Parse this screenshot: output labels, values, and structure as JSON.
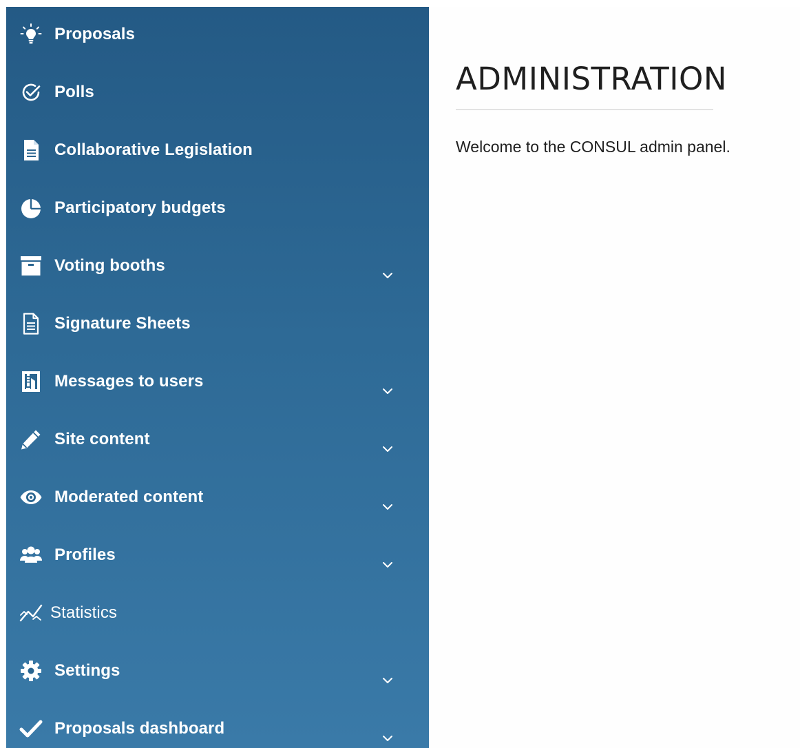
{
  "sidebar": {
    "items": [
      {
        "label": "Proposals",
        "icon": "lightbulb-icon",
        "has_submenu": false
      },
      {
        "label": "Polls",
        "icon": "check-circle-icon",
        "has_submenu": false
      },
      {
        "label": "Collaborative Legislation",
        "icon": "document-icon",
        "has_submenu": false
      },
      {
        "label": "Participatory budgets",
        "icon": "pie-chart-icon",
        "has_submenu": false
      },
      {
        "label": "Voting booths",
        "icon": "archive-box-icon",
        "has_submenu": true
      },
      {
        "label": "Signature Sheets",
        "icon": "document-lines-icon",
        "has_submenu": false
      },
      {
        "label": "Messages to users",
        "icon": "building-icon",
        "has_submenu": true
      },
      {
        "label": "Site content",
        "icon": "pencil-icon",
        "has_submenu": true
      },
      {
        "label": "Moderated content",
        "icon": "eye-icon",
        "has_submenu": true
      },
      {
        "label": "Profiles",
        "icon": "users-icon",
        "has_submenu": true
      },
      {
        "label": "Statistics",
        "icon": "line-chart-icon",
        "has_submenu": false
      },
      {
        "label": "Settings",
        "icon": "gear-icon",
        "has_submenu": true
      },
      {
        "label": "Proposals dashboard",
        "icon": "checkmark-icon",
        "has_submenu": true
      }
    ]
  },
  "main": {
    "title": "ADMINISTRATION",
    "welcome": "Welcome to the CONSUL admin panel."
  },
  "colors": {
    "sidebar_top": "#245a85",
    "sidebar_bottom": "#3a7aa8",
    "text_dark": "#1f1f1f"
  }
}
